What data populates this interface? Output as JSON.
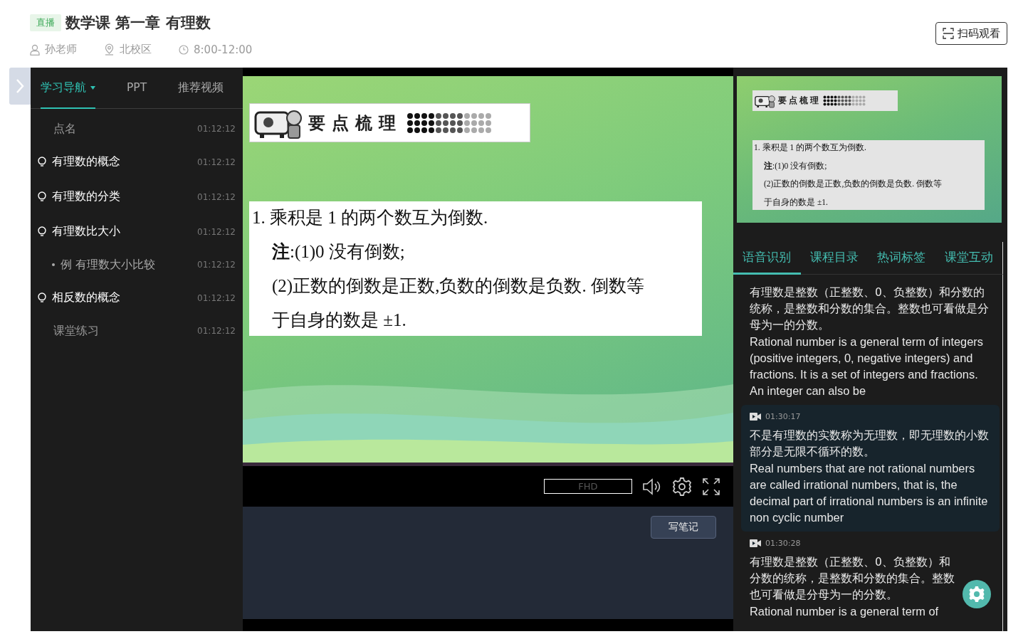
{
  "header": {
    "badge": "直播",
    "title": "数学课 第一章 有理数",
    "meta": [
      {
        "kind": "teacher",
        "text": "孙老师"
      },
      {
        "kind": "location",
        "text": "北校区"
      },
      {
        "kind": "time",
        "text": "8:00-12:00"
      }
    ],
    "scan_button": "扫码观看"
  },
  "sidebar": {
    "tabs": [
      {
        "label": "学习导航",
        "selected": true,
        "dropdown": true
      },
      {
        "label": "PPT",
        "selected": false
      },
      {
        "label": "推荐视频",
        "selected": false
      }
    ],
    "items": [
      {
        "kind": "plain",
        "label": "点名",
        "time": "01:12:12"
      },
      {
        "kind": "topic",
        "label": "有理数的概念",
        "time": "01:12:12"
      },
      {
        "kind": "topic",
        "label": "有理数的分类",
        "time": "01:12:12"
      },
      {
        "kind": "topic",
        "label": "有理数比大小",
        "time": "01:12:12",
        "children": [
          {
            "kind": "example",
            "label": "例 有理数大小比较",
            "time": "01:12:12"
          }
        ]
      },
      {
        "kind": "topic",
        "label": "相反数的概念",
        "time": "01:12:12"
      },
      {
        "kind": "plain",
        "label": "课堂练习",
        "time": "01:12:12"
      }
    ]
  },
  "player": {
    "slide": {
      "banner": "要点梳理",
      "lines": [
        "1. 乘积是 1 的两个数互为倒数.",
        "**注**:(1)0 没有倒数;",
        "(2)正数的倒数是正数,负数的倒数是负数. 倒数等",
        "于自身的数是 ±1."
      ]
    },
    "quality": "FHD",
    "note_button": "写笔记"
  },
  "thumbnail": {
    "banner": "要点梳理",
    "lines": [
      "1. 乘积是 1 的两个数互为倒数.",
      "**注**:(1)0 没有倒数;",
      "(2)正数的倒数是正数,负数的倒数是负数. 倒数等",
      "于自身的数是 ±1."
    ]
  },
  "panel": {
    "tabs": [
      {
        "label": "语音识别",
        "selected": true
      },
      {
        "label": "课程目录",
        "selected": false
      },
      {
        "label": "热词标签",
        "selected": false
      },
      {
        "label": "课堂互动",
        "selected": false
      }
    ],
    "transcripts": [
      {
        "selected": false,
        "zh": "有理数是整数（正整数、0、负整数）和分数的统称，是整数和分数的集合。整数也可看做是分母为一的分数。",
        "en": "Rational number is a general term of integers (positive integers, 0, negative integers) and fractions. It is a set of integers and fractions. An integer can also be"
      },
      {
        "selected": true,
        "time": "01:30:17",
        "zh": "不是有理数的实数称为无理数，即无理数的小数部分是无限不循环的数。",
        "en": "Real numbers that are not rational numbers are called irrational numbers, that is, the decimal part of irrational numbers is an infinite non cyclic number"
      },
      {
        "selected": false,
        "time": "01:30:28",
        "zh": "有理数是整数（正整数、0、负整数）和分数的统称，是整数和分数的集合。整数也可看做是分母为一的分数。",
        "en": "Rational number is a general term of"
      }
    ]
  }
}
